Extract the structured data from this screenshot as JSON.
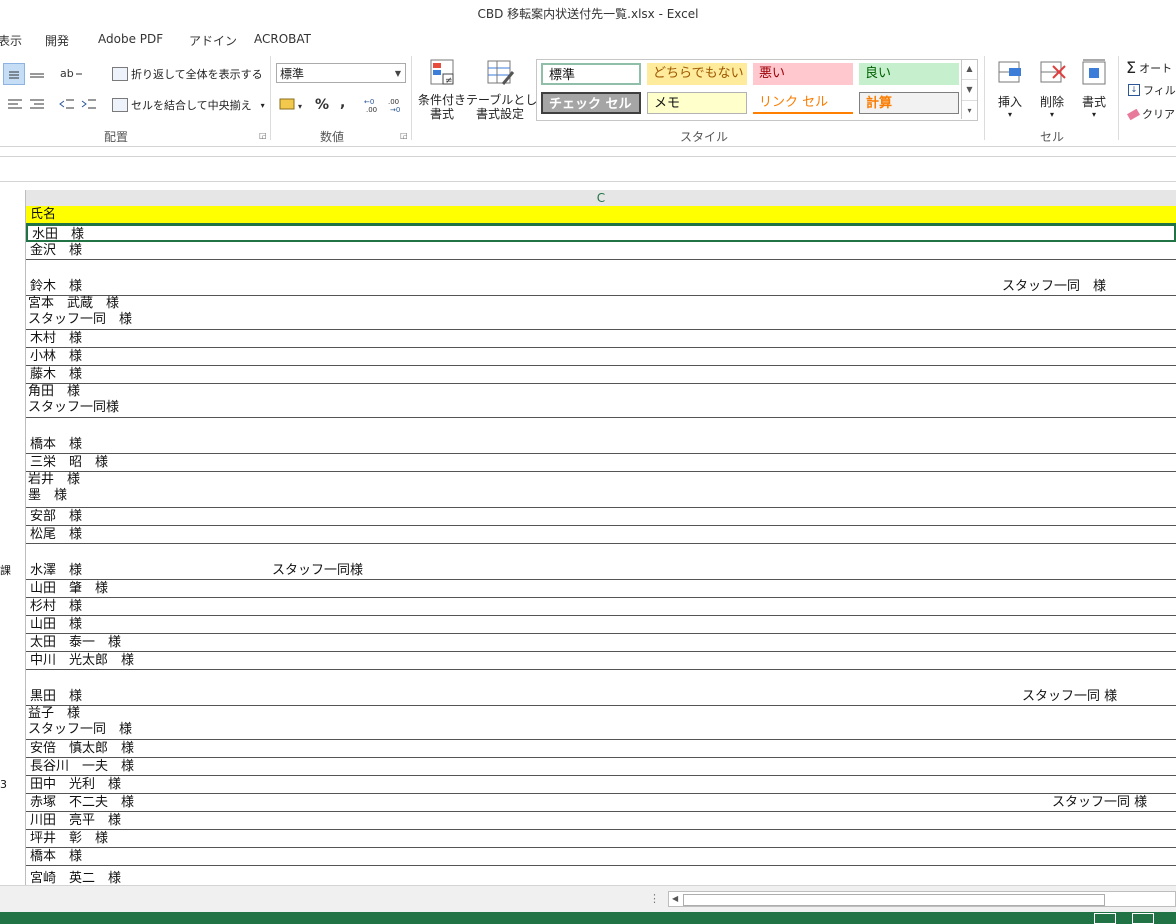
{
  "window": {
    "title": "CBD 移転案内状送付先一覧.xlsx - Excel"
  },
  "tabs": [
    "表示",
    "開発",
    "Adobe PDF",
    "アドイン",
    "ACROBAT"
  ],
  "ribbon": {
    "wrap_text": "折り返して全体を表示する",
    "merge_center": "セルを結合して中央揃え",
    "group_alignment": "配置",
    "number_format": "標準",
    "percent": "%",
    "comma": ",",
    "group_number": "数値",
    "conditional_format": "条件付き\n書式",
    "format_as_table": "テーブルとして\n書式設定",
    "group_styles": "スタイル",
    "styles": {
      "normal": "標準",
      "neutral": "どちらでもない",
      "bad": "悪い",
      "good": "良い",
      "check_cell": "チェック セル",
      "note": "メモ",
      "link_cell": "リンク セル",
      "calculation": "計算"
    },
    "insert": "挿入",
    "delete": "削除",
    "format": "書式",
    "group_cells": "セル",
    "autosum": "オート",
    "fill": "フィル",
    "clear": "クリア"
  },
  "sheet": {
    "column_header": "C",
    "rows": [
      {
        "c": "氏名",
        "extra": "",
        "left": ""
      },
      {
        "c": "水田　様",
        "extra": "",
        "left": ""
      },
      {
        "c": "金沢　様",
        "extra": "",
        "left": ""
      },
      {
        "c": "鈴木　様",
        "extra": "スタッフ一同　様",
        "left": ""
      },
      {
        "c": "宮本　武蔵　様\nスタッフ一同　様",
        "extra": "",
        "left": ""
      },
      {
        "c": "木村　様",
        "extra": "",
        "left": ""
      },
      {
        "c": "小林　様",
        "extra": "",
        "left": ""
      },
      {
        "c": "藤木　様",
        "extra": "",
        "left": ""
      },
      {
        "c": "角田　様\nスタッフ一同様",
        "extra": "",
        "left": ""
      },
      {
        "c": "橋本　様",
        "extra": "",
        "left": ""
      },
      {
        "c": "三栄　昭　様",
        "extra": "",
        "left": ""
      },
      {
        "c": "岩井　様\n墨　様",
        "extra": "",
        "left": ""
      },
      {
        "c": "安部　様",
        "extra": "",
        "left": ""
      },
      {
        "c": "松尾　様",
        "extra": "",
        "left": ""
      },
      {
        "c": "水澤　様",
        "extra": "スタッフ一同様",
        "left": "課"
      },
      {
        "c": "山田　肇　様",
        "extra": "",
        "left": ""
      },
      {
        "c": "杉村　様",
        "extra": "",
        "left": ""
      },
      {
        "c": "山田　様",
        "extra": "",
        "left": ""
      },
      {
        "c": "太田　泰一　様",
        "extra": "",
        "left": ""
      },
      {
        "c": "中川　光太郎　様",
        "extra": "",
        "left": ""
      },
      {
        "c": "黒田　様",
        "extra": "スタッフ一同 様",
        "left": ""
      },
      {
        "c": "益子　様\nスタッフ一同　様",
        "extra": "",
        "left": ""
      },
      {
        "c": "安倍　慎太郎　様",
        "extra": "",
        "left": ""
      },
      {
        "c": "長谷川　一夫　様",
        "extra": "",
        "left": ""
      },
      {
        "c": "田中　光利　様",
        "extra": "",
        "left": "3"
      },
      {
        "c": "赤塚　不二夫　様",
        "extra": "スタッフ一同 様",
        "left": ""
      },
      {
        "c": "川田　亮平　様",
        "extra": "",
        "left": ""
      },
      {
        "c": "坪井　彰　様",
        "extra": "",
        "left": ""
      },
      {
        "c": "橋本　様",
        "extra": "",
        "left": ""
      },
      {
        "c": "宮崎　英二　様",
        "extra": "",
        "left": ""
      }
    ]
  }
}
